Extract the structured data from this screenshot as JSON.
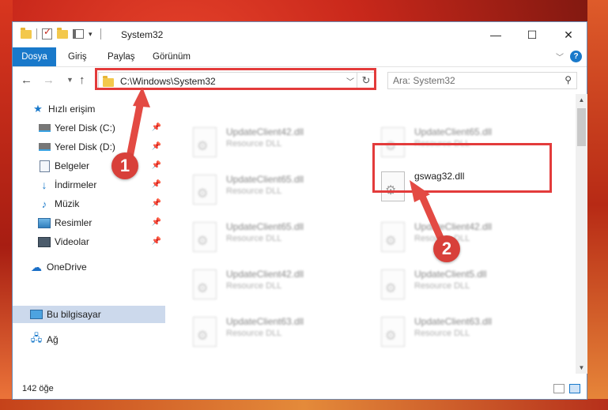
{
  "window": {
    "title": "System32",
    "controls": {
      "minimize": "—",
      "maximize": "☐",
      "close": "✕"
    }
  },
  "ribbon": {
    "file_tab": "Dosya",
    "tabs": [
      "Giriş",
      "Paylaş",
      "Görünüm"
    ]
  },
  "navigation": {
    "address": "C:\\Windows\\System32",
    "search_placeholder": "Ara: System32"
  },
  "sidebar": {
    "quick_access": "Hızlı erişim",
    "items": [
      {
        "label": "Yerel Disk (C:)",
        "icon": "drive-icon"
      },
      {
        "label": "Yerel Disk (D:)",
        "icon": "drive-icon"
      },
      {
        "label": "Belgeler",
        "icon": "documents-icon"
      },
      {
        "label": "İndirmeler",
        "icon": "downloads-icon"
      },
      {
        "label": "Müzik",
        "icon": "music-icon"
      },
      {
        "label": "Resimler",
        "icon": "pictures-icon"
      },
      {
        "label": "Videolar",
        "icon": "videos-icon"
      }
    ],
    "onedrive": "OneDrive",
    "this_pc": "Bu bilgisayar",
    "network": "Ağ"
  },
  "files": {
    "left_column": [
      {
        "name": "UpdateClient42.dll",
        "type": "Resource DLL"
      },
      {
        "name": "UpdateClient65.dll",
        "type": "Resource DLL"
      },
      {
        "name": "UpdateClient65.dll",
        "type": "Resource DLL"
      },
      {
        "name": "UpdateClient42.dll",
        "type": "Resource DLL"
      },
      {
        "name": "UpdateClient63.dll",
        "type": "Resource DLL"
      }
    ],
    "right_column": [
      {
        "name": "UpdateClient65.dll",
        "type": "Resource DLL"
      },
      {
        "name": "gswag32.dll",
        "type": ""
      },
      {
        "name": "UpdateClient42.dll",
        "type": "Resource DLL"
      },
      {
        "name": "UpdateClient5.dll",
        "type": "Resource DLL"
      },
      {
        "name": "UpdateClient63.dll",
        "type": "Resource DLL"
      }
    ]
  },
  "status": {
    "item_count": "142 öğe"
  },
  "annotations": {
    "step1": "1",
    "step2": "2",
    "highlight_color": "#e33b3b"
  }
}
